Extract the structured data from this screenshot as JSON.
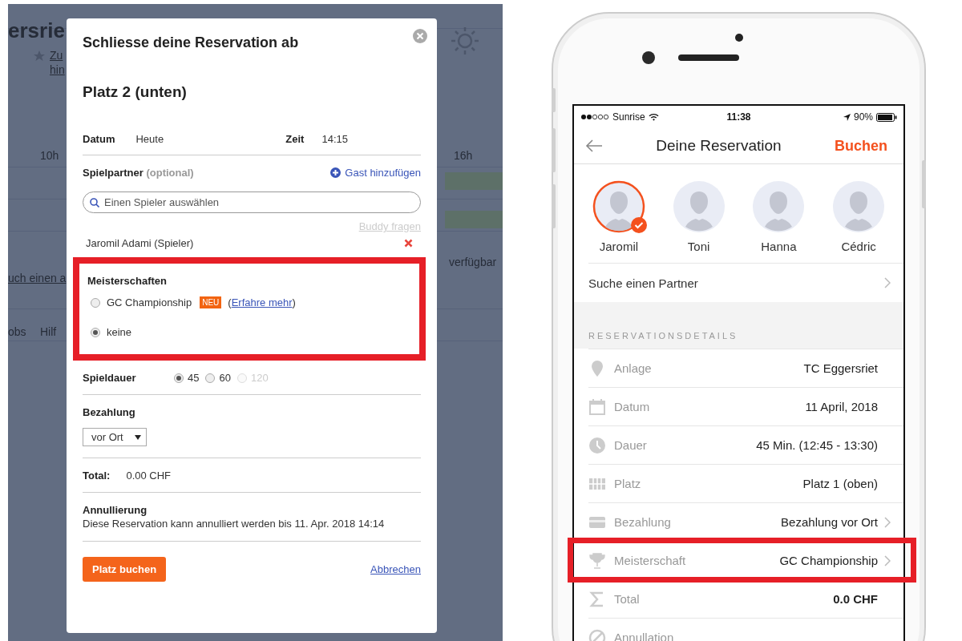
{
  "web_dialog": {
    "background_page": {
      "fragments": [
        {
          "kind": "heading",
          "text": "ersrie"
        },
        {
          "kind": "link",
          "text": "Zu"
        },
        {
          "kind": "link2",
          "text": "hin"
        },
        {
          "kind": "hour",
          "text": "10h"
        },
        {
          "kind": "hour2",
          "text": "16h"
        },
        {
          "kind": "status",
          "text": "verfügbar"
        },
        {
          "kind": "link3",
          "text": "uch einen a"
        },
        {
          "kind": "footer",
          "text": "obs"
        },
        {
          "kind": "footer2",
          "text": "Hilf"
        }
      ]
    },
    "title": "Schliesse deine Reservation ab",
    "court": "Platz 2 (unten)",
    "date": {
      "label": "Datum",
      "value": "Heute"
    },
    "time": {
      "label": "Zeit",
      "value": "14:15"
    },
    "partner": {
      "label": "Spielpartner",
      "hint": "(optional)",
      "add_guest": "Gast hinzufügen",
      "search_placeholder": "Einen Spieler auswählen",
      "buddy_link": "Buddy fragen",
      "players": [
        {
          "name": "Jaromil Adami (Spieler)"
        }
      ]
    },
    "championships": {
      "label": "Meisterschaften",
      "highlighted": true,
      "options": [
        {
          "label": "GC Championship",
          "badge": "NEU",
          "link_open": "(",
          "link": "Erfahre mehr",
          "link_close": ")",
          "selected": false
        },
        {
          "label": "keine",
          "selected": true
        }
      ]
    },
    "duration": {
      "label": "Spieldauer",
      "options": [
        {
          "label": "45",
          "selected": true,
          "disabled": false
        },
        {
          "label": "60",
          "selected": false,
          "disabled": false
        },
        {
          "label": "120",
          "selected": false,
          "disabled": true
        }
      ]
    },
    "payment": {
      "label": "Bezahlung",
      "value": "vor Ort"
    },
    "total": {
      "label": "Total:",
      "value": "0.00 CHF"
    },
    "cancellation": {
      "label": "Annullierung",
      "text": "Diese Reservation kann annulliert werden bis 11. Apr. 2018 14:14"
    },
    "book_button": "Platz buchen",
    "cancel_link": "Abbrechen"
  },
  "phone": {
    "status_bar": {
      "carrier": "Sunrise",
      "time": "11:38",
      "battery": "90%"
    },
    "nav": {
      "title": "Deine Reservation",
      "action": "Buchen"
    },
    "players": [
      {
        "name": "Jaromil",
        "selected": true
      },
      {
        "name": "Toni",
        "selected": false
      },
      {
        "name": "Hanna",
        "selected": false
      },
      {
        "name": "Cédric",
        "selected": false
      }
    ],
    "search_partner": "Suche einen Partner",
    "section_header": "RESERVATIONSDETAILS",
    "details": [
      {
        "kind": "location",
        "label": "Anlage",
        "value": "TC Eggersriet",
        "chevron": false,
        "highlighted": false,
        "emphasis": false
      },
      {
        "kind": "calendar",
        "label": "Datum",
        "value": "11 April, 2018",
        "chevron": false,
        "highlighted": false,
        "emphasis": false
      },
      {
        "kind": "clock",
        "label": "Dauer",
        "value": "45 Min. (12:45 - 13:30)",
        "chevron": false,
        "highlighted": false,
        "emphasis": false
      },
      {
        "kind": "court",
        "label": "Platz",
        "value": "Platz 1 (oben)",
        "chevron": false,
        "highlighted": false,
        "emphasis": false
      },
      {
        "kind": "card",
        "label": "Bezahlung",
        "value": "Bezahlung vor Ort",
        "chevron": true,
        "highlighted": false,
        "emphasis": false
      },
      {
        "kind": "trophy",
        "label": "Meisterschaft",
        "value": "GC Championship",
        "chevron": true,
        "highlighted": true,
        "emphasis": false
      },
      {
        "kind": "sum",
        "label": "Total",
        "value": "0.0 CHF",
        "chevron": false,
        "highlighted": false,
        "emphasis": true
      },
      {
        "kind": "cancel",
        "label": "Annullation",
        "chevron": false,
        "highlighted": false
      }
    ]
  }
}
